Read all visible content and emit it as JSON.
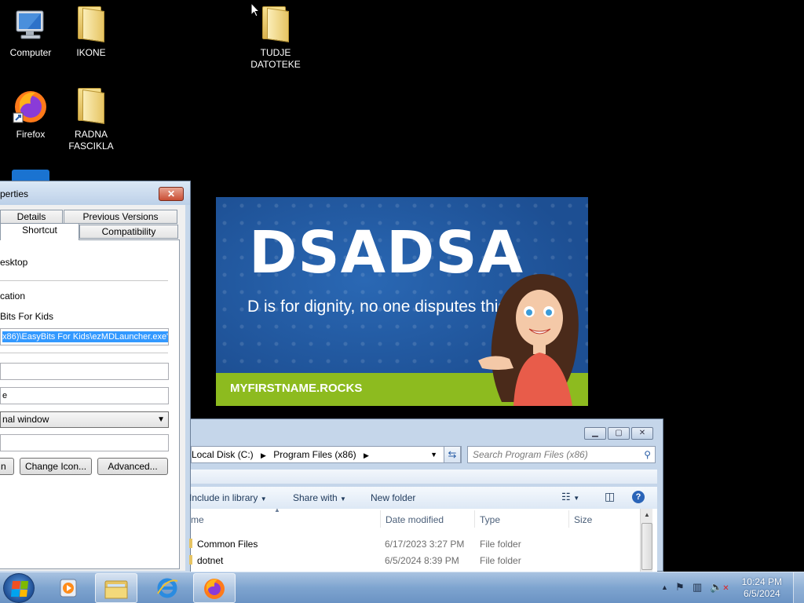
{
  "desktop": {
    "icons": [
      {
        "label": "Computer"
      },
      {
        "label": "IKONE"
      },
      {
        "label": "TUDJE\nDATOTEKE"
      },
      {
        "label": "Firefox"
      },
      {
        "label": "RADNA\nFASCIKLA"
      }
    ]
  },
  "properties": {
    "title": "perties",
    "close_label": "✕",
    "tabs": {
      "details": "Details",
      "previous_versions": "Previous Versions",
      "shortcut": "Shortcut",
      "compatibility": "Compatibility"
    },
    "target_type_value": "esktop",
    "target_location_label": "cation",
    "target_location_value": "Bits For Kids",
    "target_value": "x86)\\EasyBits For Kids\\ezMDLauncher.exe\"",
    "start_in_value": "",
    "shortcut_key_value": "e",
    "run_value": "nal window",
    "comment_value": "",
    "buttons": {
      "open_location": "n",
      "change_icon": "Change Icon...",
      "advanced": "Advanced..."
    }
  },
  "banner": {
    "title": "DSADSA",
    "tagline": "D is for dignity, no one disputes this trait!",
    "footer": "MYFIRSTNAME.ROCKS"
  },
  "explorer": {
    "address": {
      "seg1": "Local Disk (C:)",
      "seg2": "Program Files (x86)"
    },
    "search_placeholder": "Search Program Files (x86)",
    "toolbar": {
      "include_in_library": "Include in library",
      "share_with": "Share with",
      "new_folder": "New folder"
    },
    "columns": {
      "name": "me",
      "date_modified": "Date modified",
      "type": "Type",
      "size": "Size"
    },
    "rows": [
      {
        "name": "Common Files",
        "date": "6/17/2023 3:27 PM",
        "type": "File folder"
      },
      {
        "name": "dotnet",
        "date": "6/5/2024 8:39 PM",
        "type": "File folder"
      }
    ]
  },
  "taskbar": {
    "time": "10:24 PM",
    "date": "6/5/2024"
  },
  "colors": {
    "desktop_bg": "#000000",
    "banner_blue": "#1d4f93",
    "banner_green": "#8dbb1f",
    "selection_blue": "#3399ff"
  }
}
